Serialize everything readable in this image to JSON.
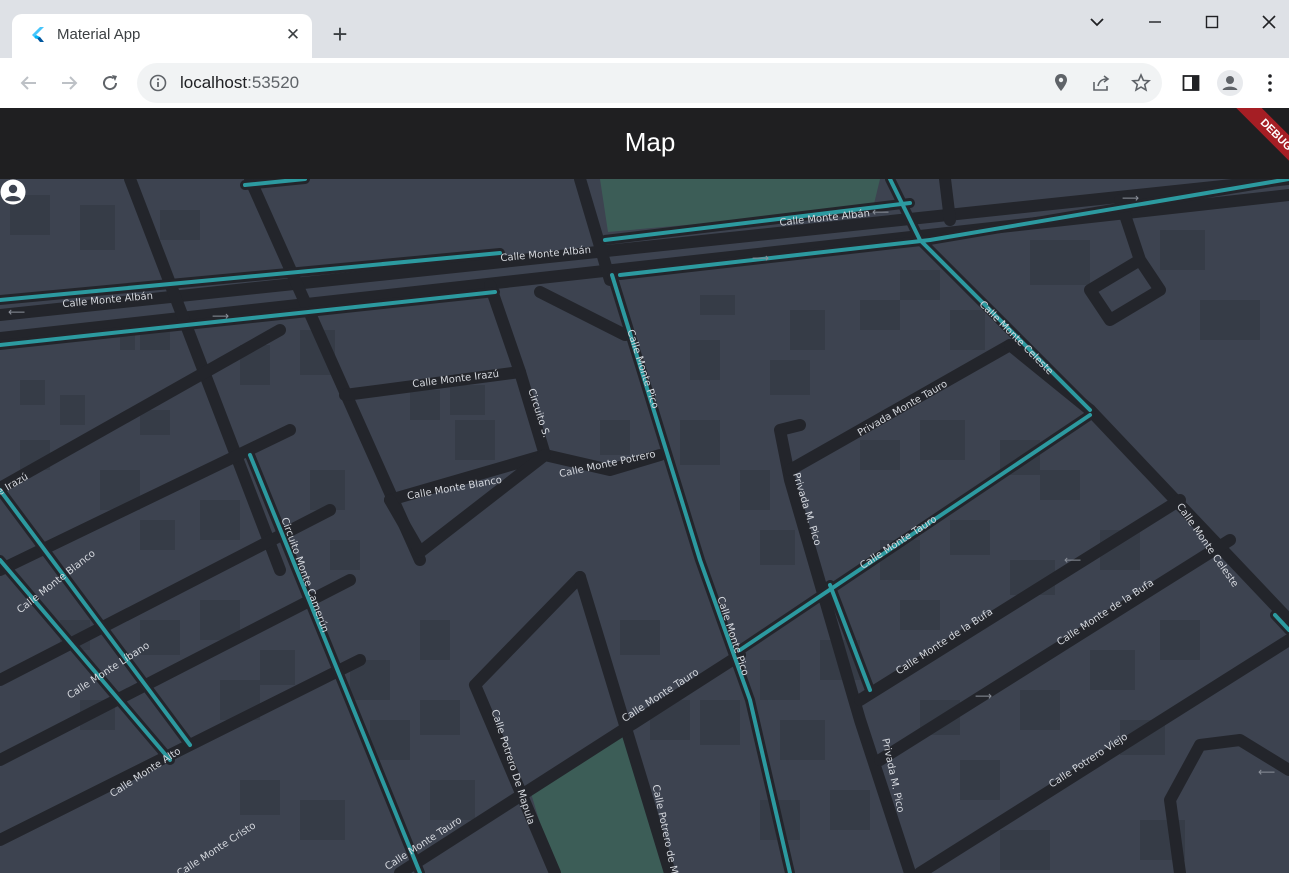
{
  "browser": {
    "tab_title": "Material App",
    "close_tab_symbol": "✕",
    "new_tab_symbol": "+",
    "url_host": "localhost",
    "url_port": ":53520",
    "icons": {
      "favicon": "flutter-icon",
      "back": "back-arrow-icon",
      "forward": "forward-arrow-icon",
      "reload": "reload-icon",
      "site_info": "info-icon",
      "location": "location-pin-icon",
      "share": "share-icon",
      "bookmark": "star-icon",
      "side_panel": "side-panel-icon",
      "profile": "profile-avatar-icon",
      "menu": "kebab-menu-icon"
    }
  },
  "app": {
    "title": "Map",
    "debug_banner": "DEBUG"
  },
  "map": {
    "colors": {
      "background": "#3d4350",
      "road": "#23252b",
      "highlight_road": "#2c9aa0",
      "park": "#3c5d57",
      "building": "#363c47"
    },
    "user_marker": "user-location-icon",
    "labels": [
      "Calle Monte Albán",
      "Calle Monte Albán",
      "Calle Monte Albán",
      "Calle Monte Irazú",
      "Circuito S.",
      "Calle Monte Potrero",
      "Calle Monte Blanco",
      "Calle Monte Pico",
      "Privada Monte Tauro",
      "Calle Monte Celeste",
      "Privada M. Pico",
      "Calle Monte Tauro",
      "Calle Monte Celeste",
      "Calle Monte Blanco",
      "Circuito Monte Camerún",
      "Calle Monte Líbano",
      "Calle Monte Alto",
      "Calle Monte Cristo",
      "Calle Monte Tauro",
      "Calle Potrero De Mapula",
      "Calle Potrero de M",
      "Calle Monte Tauro",
      "Calle Monte Pico",
      "Calle Monte de la Bufa",
      "Calle Monte de la Bufa",
      "Privada M. Pico",
      "Calle Potrero Viejo",
      "e Irazú"
    ]
  }
}
